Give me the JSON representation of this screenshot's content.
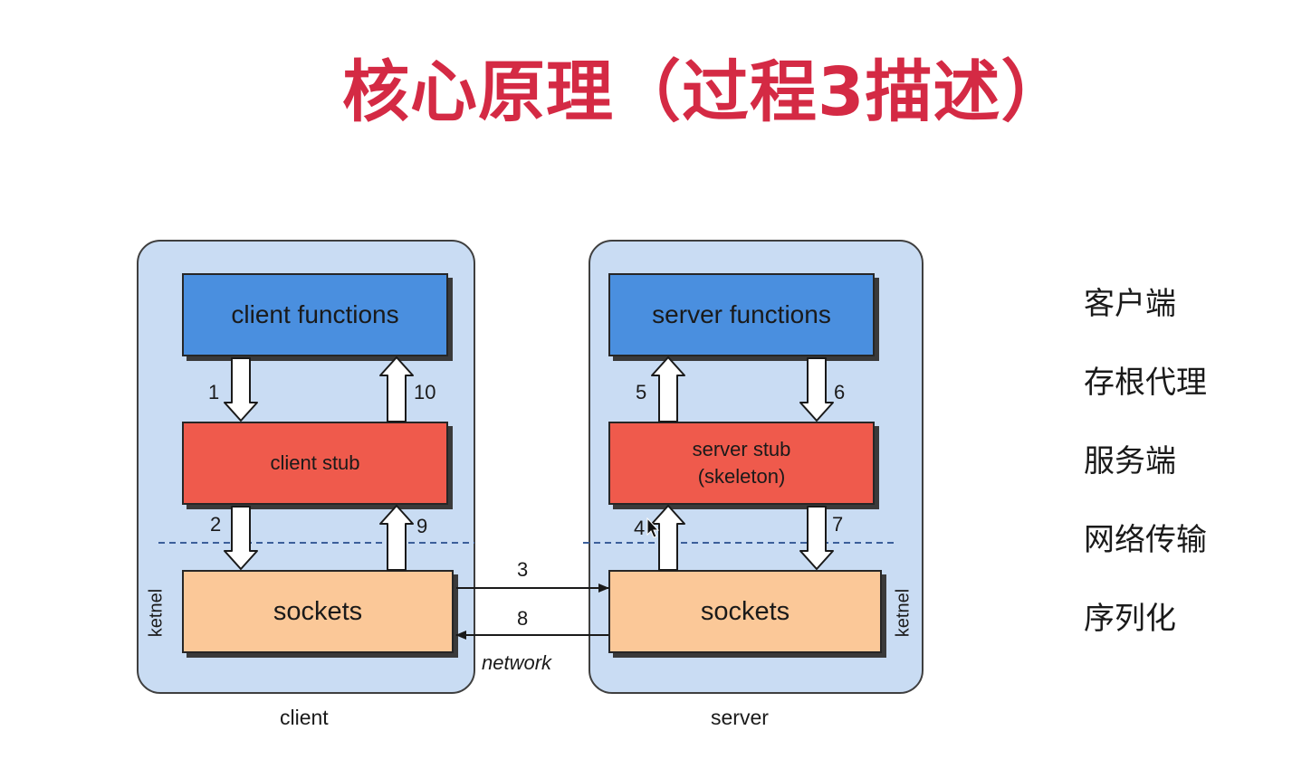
{
  "title": "核心原理（过程3描述）",
  "client": {
    "caption": "client",
    "side_label": "ketnel",
    "functions": "client functions",
    "stub": "client stub",
    "sockets": "sockets"
  },
  "server": {
    "caption": "server",
    "side_label": "ketnel",
    "functions": "server functions",
    "stub_line1": "server stub",
    "stub_line2": "(skeleton)",
    "sockets": "sockets"
  },
  "network_label": "network",
  "steps": {
    "s1": "1",
    "s2": "2",
    "s3": "3",
    "s4": "4",
    "s5": "5",
    "s6": "6",
    "s7": "7",
    "s8": "8",
    "s9": "9",
    "s10": "10"
  },
  "legend": [
    "客户端",
    "存根代理",
    "服务端",
    "网络传输",
    "序列化"
  ],
  "colors": {
    "title": "#d42a44",
    "panel": "#c9dcf3",
    "functions_box": "#4a8fdf",
    "stub_box": "#ef5a4c",
    "sockets_box": "#fbc898",
    "dashed_line": "#3b5f9a"
  }
}
